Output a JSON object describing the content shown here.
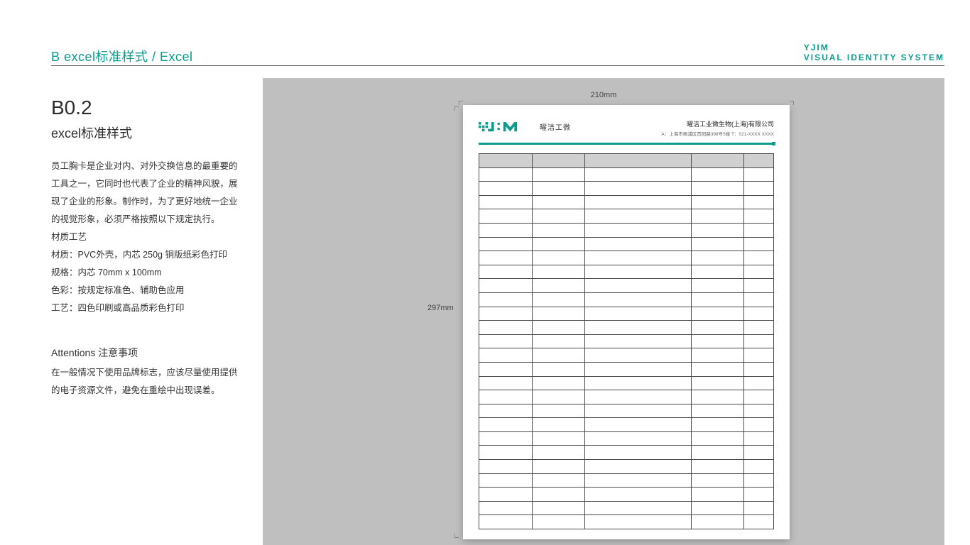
{
  "header": {
    "title": "B excel标准样式 / Excel",
    "brand_line1": "YJIM",
    "brand_line2": "VISUAL IDENTITY SYSTEM"
  },
  "left": {
    "code": "B0.2",
    "subhead": "excel标准样式",
    "para1": "员工胸卡是企业对内、对外交换信息的最重要的工具之一，它同时也代表了企业的精神风貌，展现了企业的形象。制作时，为了更好地统一企业的视觉形象，必须严格按照以下规定执行。",
    "para2": "材质工艺",
    "para3": "材质：PVC外壳，内芯 250g 铜版纸彩色打印",
    "para4": "规格：内芯 70mm x 100mm",
    "para5": "色彩：按规定标准色、辅助色应用",
    "para6": "工艺：四色印刷或高品质彩色打印",
    "attn_head": "Attentions 注意事项",
    "attn_body": "在一般情况下使用品牌标志，应该尽量使用提供的电子资源文件，避免在重绘中出现误差。"
  },
  "stage": {
    "dim_w": "210mm",
    "dim_h": "297mm"
  },
  "sheet": {
    "logo_text_cn": "曜洁工微",
    "company_name": "曜洁工业微生物(上海)有限公司",
    "company_addr": "A：上海市杨浦区贵阳路398号5楼    T：021-XXXX XXXX"
  },
  "colors": {
    "brand": "#0a9d8d"
  },
  "table": {
    "row_count": 26,
    "col_count": 5
  }
}
